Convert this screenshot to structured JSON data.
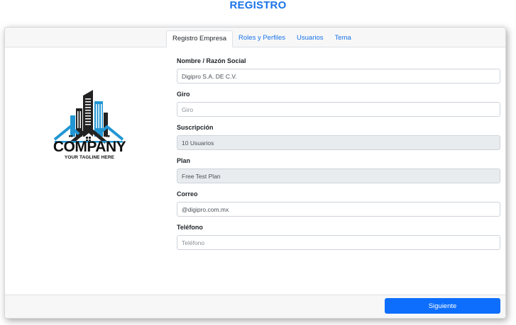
{
  "page": {
    "title": "REGISTRO"
  },
  "tabs": [
    {
      "label": "Registro Empresa",
      "active": true
    },
    {
      "label": "Roles y Perfiles",
      "active": false
    },
    {
      "label": "Usuarios",
      "active": false
    },
    {
      "label": "Tema",
      "active": false
    }
  ],
  "logo": {
    "name": "COMPANY",
    "tagline": "YOUR TAGLINE HERE",
    "icon": "buildings-houses-logo",
    "colors": {
      "dark": "#222222",
      "accent": "#2196d3"
    }
  },
  "form": {
    "fields": [
      {
        "label": "Nombre / Razón Social",
        "value": "Digipro S.A. DE C.V.",
        "placeholder": "",
        "readonly": false
      },
      {
        "label": "Giro",
        "value": "",
        "placeholder": "Giro",
        "readonly": false
      },
      {
        "label": "Suscripción",
        "value": "10 Usuarios",
        "placeholder": "",
        "readonly": true
      },
      {
        "label": "Plan",
        "value": "Free Test Plan",
        "placeholder": "",
        "readonly": true
      },
      {
        "label": "Correo",
        "value": "@digipro.com.mx",
        "placeholder": "",
        "readonly": false
      },
      {
        "label": "Teléfono",
        "value": "",
        "placeholder": "Teléfono",
        "readonly": false
      }
    ]
  },
  "footer": {
    "next_label": "Siguiente"
  },
  "colors": {
    "accent": "#1a73e8",
    "primary_button": "#0d6efd",
    "readonly_bg": "#e9ecef"
  }
}
